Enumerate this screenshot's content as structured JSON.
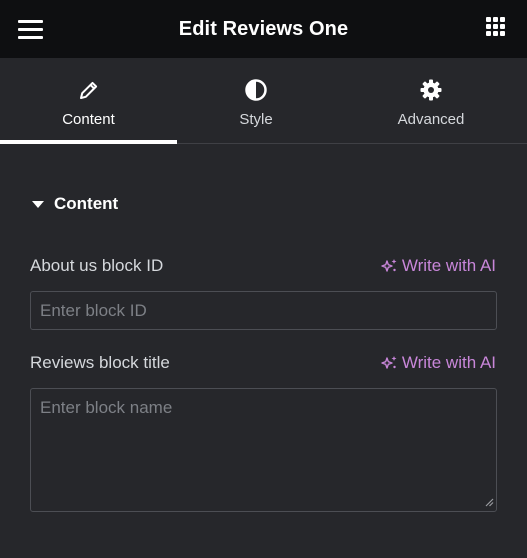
{
  "header": {
    "title": "Edit Reviews One",
    "menu_icon": "hamburger-icon",
    "apps_icon": "grid-icon"
  },
  "tabs": [
    {
      "label": "Content",
      "icon": "pencil-icon",
      "active": true
    },
    {
      "label": "Style",
      "icon": "half-circle-icon",
      "active": false
    },
    {
      "label": "Advanced",
      "icon": "gear-icon",
      "active": false
    }
  ],
  "section": {
    "title": "Content",
    "expanded": true
  },
  "fields": {
    "about_us": {
      "label": "About us block ID",
      "ai_label": "Write with AI",
      "value": "",
      "placeholder": "Enter block ID"
    },
    "reviews_title": {
      "label": "Reviews block title",
      "ai_label": "Write with AI",
      "value": "",
      "placeholder": "Enter block name"
    }
  },
  "colors": {
    "header_bg": "#0e0f11",
    "panel_bg": "#26272b",
    "ai_accent": "#c886d9",
    "active_tab_indicator": "#ffffff"
  }
}
